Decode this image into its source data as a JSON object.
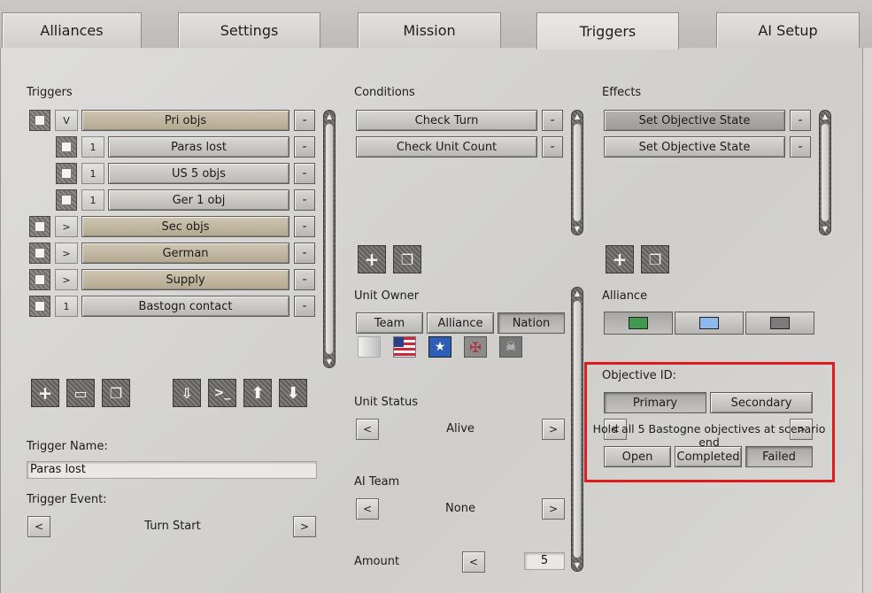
{
  "tabs": [
    {
      "label": "Alliances"
    },
    {
      "label": "Settings"
    },
    {
      "label": "Mission"
    },
    {
      "label": "Triggers",
      "active": true
    },
    {
      "label": "AI Setup"
    }
  ],
  "triggers": {
    "heading": "Triggers",
    "items": [
      {
        "toggle": "V",
        "label": "Pri objs",
        "style": "tan",
        "minus": "-"
      },
      {
        "toggle": "1",
        "label": "Paras lost",
        "style": "grey",
        "minus": "-"
      },
      {
        "toggle": "1",
        "label": "US 5 objs",
        "style": "grey",
        "minus": "-"
      },
      {
        "toggle": "1",
        "label": "Ger 1 obj",
        "style": "grey",
        "minus": "-"
      },
      {
        "toggle": ">",
        "label": "Sec objs",
        "style": "tan",
        "minus": "-"
      },
      {
        "toggle": ">",
        "label": "German",
        "style": "tan",
        "minus": "-"
      },
      {
        "toggle": ">",
        "label": "Supply",
        "style": "tan",
        "minus": "-"
      },
      {
        "toggle": "1",
        "label": "Bastogn contact",
        "style": "grey",
        "minus": "-"
      }
    ],
    "trigger_name_label": "Trigger Name:",
    "trigger_name_value": "Paras lost",
    "trigger_event_label": "Trigger Event:",
    "trigger_event_value": "Turn Start",
    "prev": "<",
    "next": ">"
  },
  "conditions": {
    "heading": "Conditions",
    "items": [
      {
        "label": "Check Turn",
        "minus": "-"
      },
      {
        "label": "Check Unit Count",
        "minus": "-"
      }
    ],
    "unit_owner_label": "Unit Owner",
    "owner_buttons": [
      {
        "label": "Team"
      },
      {
        "label": "Alliance"
      },
      {
        "label": "Nation",
        "pressed": true
      }
    ],
    "unit_status_label": "Unit Status",
    "unit_status_value": "Alive",
    "ai_team_label": "AI Team",
    "ai_team_value": "None",
    "amount_label": "Amount",
    "amount_value": "5",
    "prev": "<",
    "next": ">"
  },
  "effects": {
    "heading": "Effects",
    "items": [
      {
        "label": "Set Objective State",
        "minus": "-"
      },
      {
        "label": "Set Objective State",
        "minus": "-"
      }
    ],
    "alliance_label": "Alliance",
    "alliance_colors": [
      "#3f9a4d",
      "#8fb8ee",
      "#7c7c7c"
    ],
    "objective_id_label": "Objective ID:",
    "objective_type_buttons": [
      {
        "label": "Primary",
        "pressed": true
      },
      {
        "label": "Secondary"
      }
    ],
    "objective_text": "Hold all 5 Bastogne objectives at scenario end",
    "state_buttons": [
      {
        "label": "Open"
      },
      {
        "label": "Completed"
      },
      {
        "label": "Failed",
        "pressed": true
      }
    ],
    "prev": "<",
    "next": ">"
  },
  "colors": {
    "highlight": "#e01b1b",
    "tan_button": "#c2b79f"
  }
}
